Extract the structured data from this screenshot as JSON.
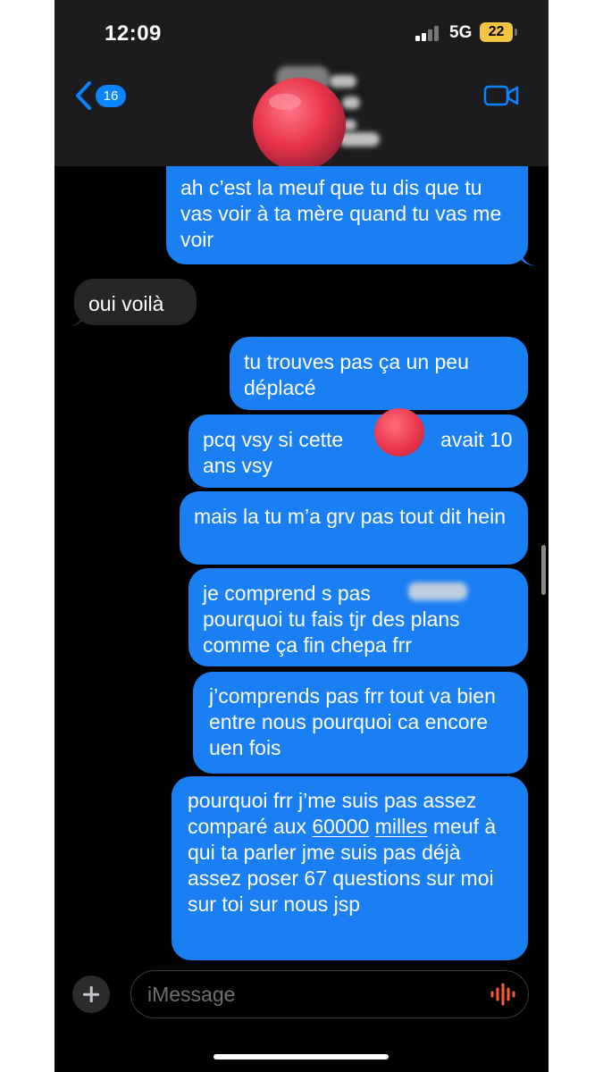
{
  "status_bar": {
    "time": "12:09",
    "network": "5G",
    "battery": "22"
  },
  "header": {
    "back_badge": "16"
  },
  "messages": [
    {
      "direction": "sent",
      "text": "ah c’est la meuf que tu dis que tu vas voir à ta mère quand tu vas me voir"
    },
    {
      "direction": "received",
      "text": "oui voilà"
    },
    {
      "direction": "sent",
      "text": "tu trouves pas ça un peu déplacé"
    },
    {
      "direction": "sent",
      "text_before": "pcq vsy si cette",
      "text_after": "avait 10 ans vsy"
    },
    {
      "direction": "sent",
      "text": "mais la tu m’a grv pas tout dit hein"
    },
    {
      "direction": "sent",
      "text_before": "je comprend s pas",
      "text_after": "pourquoi tu fais tjr des plans comme ça fin chepa frr"
    },
    {
      "direction": "sent",
      "text": "j’comprends pas frr tout va bien entre nous pourquoi ca encore uen fois"
    },
    {
      "direction": "sent",
      "text_before": "pourquoi frr j’me suis pas assez comparé aux",
      "link_part1": "60000",
      "link_part2": "milles",
      "text_after": "meuf à qui ta parler jme suis pas déjà assez poser 67 questions sur moi sur toi sur nous jsp"
    }
  ],
  "composer": {
    "placeholder": "iMessage"
  },
  "colors": {
    "sent_bubble": "#1a7ff2",
    "received_bubble": "#262628",
    "accent": "#0a84ff",
    "battery": "#f4c542"
  },
  "icons": {
    "back": "chevron-left-icon",
    "video": "video-camera-icon",
    "add": "plus-icon",
    "audio": "waveform-icon"
  }
}
